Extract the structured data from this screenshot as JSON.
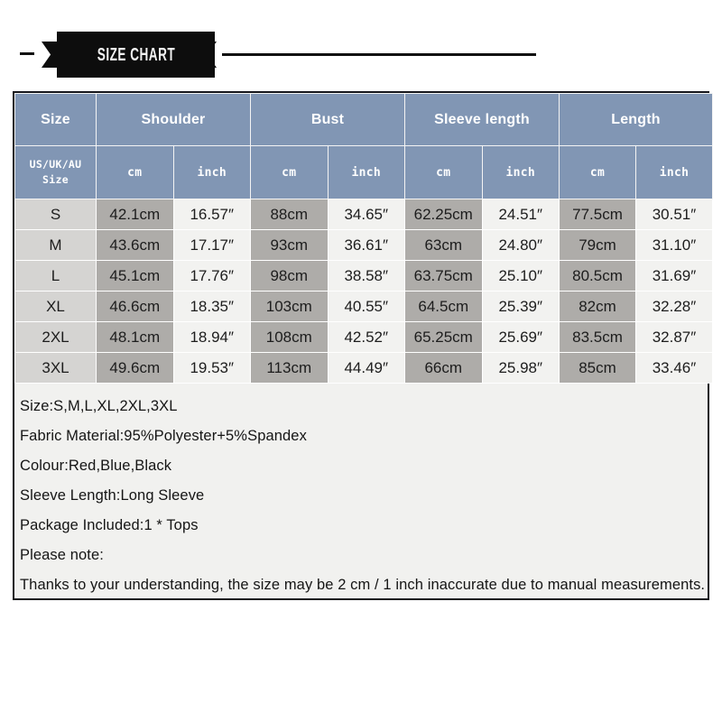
{
  "banner": {
    "title": "SIZE CHART",
    "accent_color": "#0d0d0d",
    "rule_color": "#111111"
  },
  "table": {
    "header_bg": "#8196b4",
    "group_headers": [
      {
        "label": "Size",
        "span": 1
      },
      {
        "label": "Shoulder",
        "span": 2
      },
      {
        "label": "Bust",
        "span": 2
      },
      {
        "label": "Sleeve length",
        "span": 2
      },
      {
        "label": "Length",
        "span": 2
      }
    ],
    "sub_headers": [
      "US/UK/AU\nSize",
      "cm",
      "inch",
      "cm",
      "inch",
      "cm",
      "inch",
      "cm",
      "inch"
    ],
    "sub_header_size_line1": "US/UK/AU",
    "sub_header_size_line2": "Size",
    "rows": [
      {
        "size": "S",
        "shoulder_cm": "42.1cm",
        "shoulder_in": "16.57″",
        "bust_cm": "88cm",
        "bust_in": "34.65″",
        "sleeve_cm": "62.25cm",
        "sleeve_in": "24.51″",
        "length_cm": "77.5cm",
        "length_in": "30.51″"
      },
      {
        "size": "M",
        "shoulder_cm": "43.6cm",
        "shoulder_in": "17.17″",
        "bust_cm": "93cm",
        "bust_in": "36.61″",
        "sleeve_cm": "63cm",
        "sleeve_in": "24.80″",
        "length_cm": "79cm",
        "length_in": "31.10″"
      },
      {
        "size": "L",
        "shoulder_cm": "45.1cm",
        "shoulder_in": "17.76″",
        "bust_cm": "98cm",
        "bust_in": "38.58″",
        "sleeve_cm": "63.75cm",
        "sleeve_in": "25.10″",
        "length_cm": "80.5cm",
        "length_in": "31.69″"
      },
      {
        "size": "XL",
        "shoulder_cm": "46.6cm",
        "shoulder_in": "18.35″",
        "bust_cm": "103cm",
        "bust_in": "40.55″",
        "sleeve_cm": "64.5cm",
        "sleeve_in": "25.39″",
        "length_cm": "82cm",
        "length_in": "32.28″"
      },
      {
        "size": "2XL",
        "shoulder_cm": "48.1cm",
        "shoulder_in": "18.94″",
        "bust_cm": "108cm",
        "bust_in": "42.52″",
        "sleeve_cm": "65.25cm",
        "sleeve_in": "25.69″",
        "length_cm": "83.5cm",
        "length_in": "32.87″"
      },
      {
        "size": "3XL",
        "shoulder_cm": "49.6cm",
        "shoulder_in": "19.53″",
        "bust_cm": "113cm",
        "bust_in": "44.49″",
        "sleeve_cm": "66cm",
        "sleeve_in": "25.98″",
        "length_cm": "85cm",
        "length_in": "33.46″"
      }
    ],
    "column_colors": {
      "size": "#d5d4d2",
      "cm": "#aeaca9",
      "inch": "#f2f2f0"
    }
  },
  "description": {
    "lines": [
      "Size:S,M,L,XL,2XL,3XL",
      "Fabric Material:95%Polyester+5%Spandex",
      "Colour:Red,Blue,Black",
      "Sleeve Length:Long Sleeve",
      "Package Included:1 * Tops",
      "Please note:",
      "Thanks to your understanding, the size may be 2 cm / 1 inch inaccurate due to manual measurements."
    ]
  }
}
